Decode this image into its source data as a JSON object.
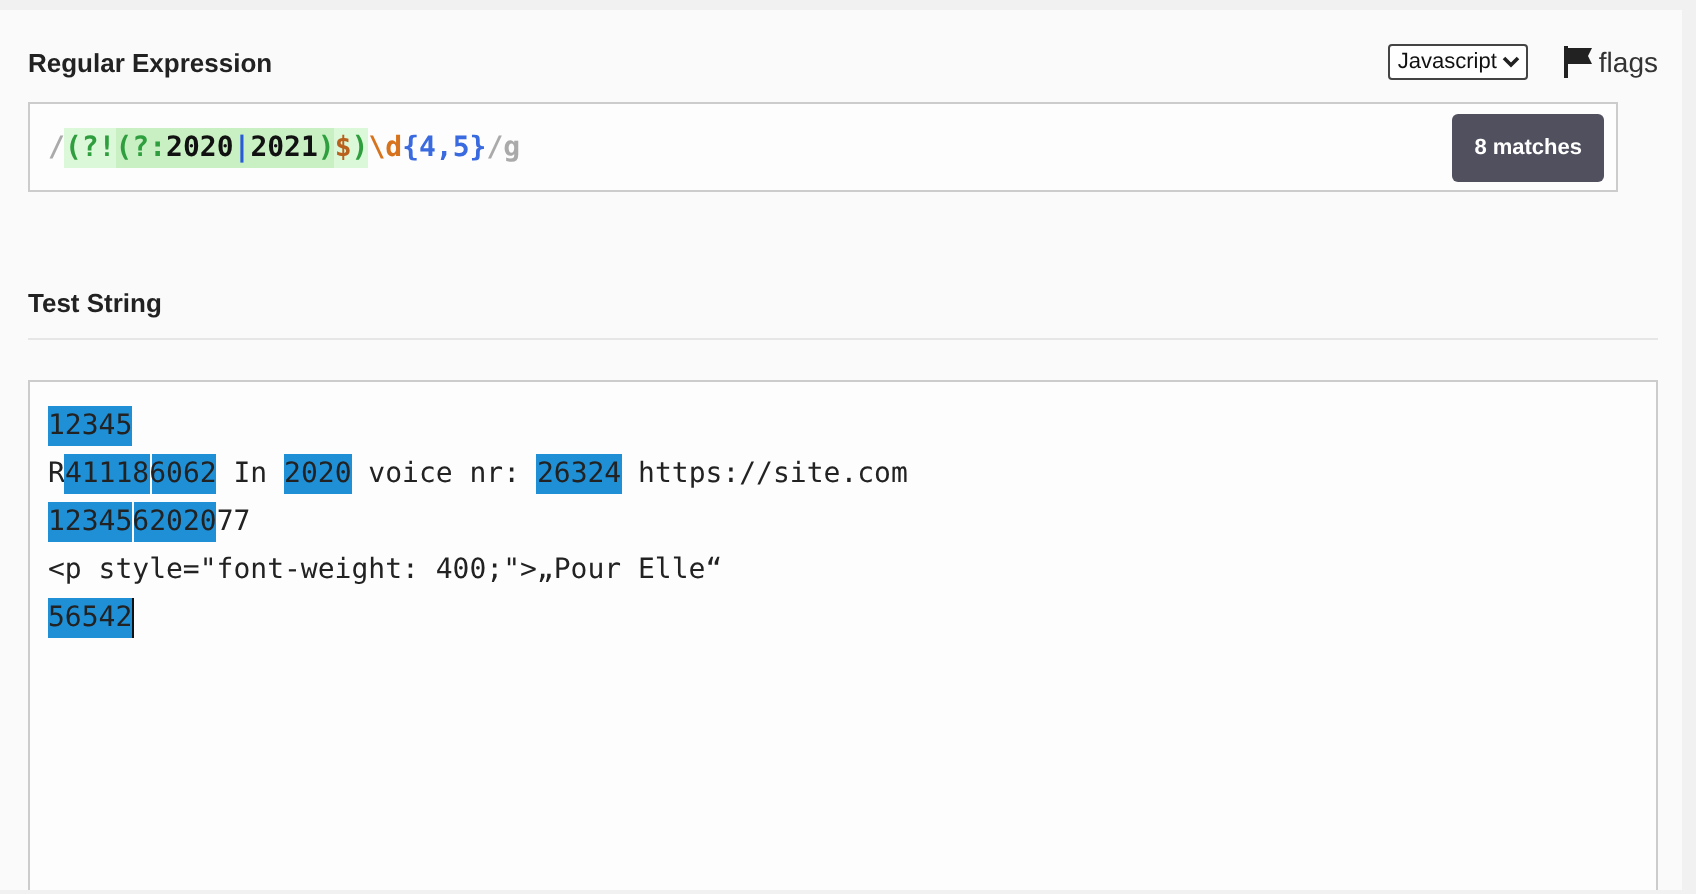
{
  "regex": {
    "label": "Regular Expression",
    "flavor": "Javascript",
    "flags_label": "flags",
    "match_count": "8 matches",
    "tokens": [
      {
        "text": "/",
        "kind": "delimiter"
      },
      {
        "text": "(?!",
        "kind": "lookahead"
      },
      {
        "text": "(?:",
        "kind": "group"
      },
      {
        "text": "2020",
        "kind": "literal"
      },
      {
        "text": "|",
        "kind": "alternation"
      },
      {
        "text": "2021",
        "kind": "literal"
      },
      {
        "text": ")",
        "kind": "group"
      },
      {
        "text": "$",
        "kind": "anchor"
      },
      {
        "text": ")",
        "kind": "lookahead"
      },
      {
        "text": "\\d",
        "kind": "escape"
      },
      {
        "text": "{4,5}",
        "kind": "quantifier"
      },
      {
        "text": "/g",
        "kind": "delimiter"
      }
    ]
  },
  "test": {
    "label": "Test String",
    "lines": [
      [
        {
          "text": "12345",
          "match": true
        }
      ],
      [
        {
          "text": "R",
          "match": false
        },
        {
          "text": "41118",
          "match": true
        },
        {
          "text": "6062",
          "match": true
        },
        {
          "text": " In ",
          "match": false
        },
        {
          "text": "2020",
          "match": true
        },
        {
          "text": " voice nr: ",
          "match": false
        },
        {
          "text": "26324",
          "match": true
        },
        {
          "text": " https://site.com",
          "match": false
        }
      ],
      [
        {
          "text": "12345",
          "match": true
        },
        {
          "text": "62020",
          "match": true
        },
        {
          "text": "77",
          "match": false
        }
      ],
      [
        {
          "text": "<p style=\"font-weight: 400;\">„Pour Elle“",
          "match": false
        }
      ],
      [
        {
          "text": "56542",
          "match": true
        }
      ]
    ]
  }
}
